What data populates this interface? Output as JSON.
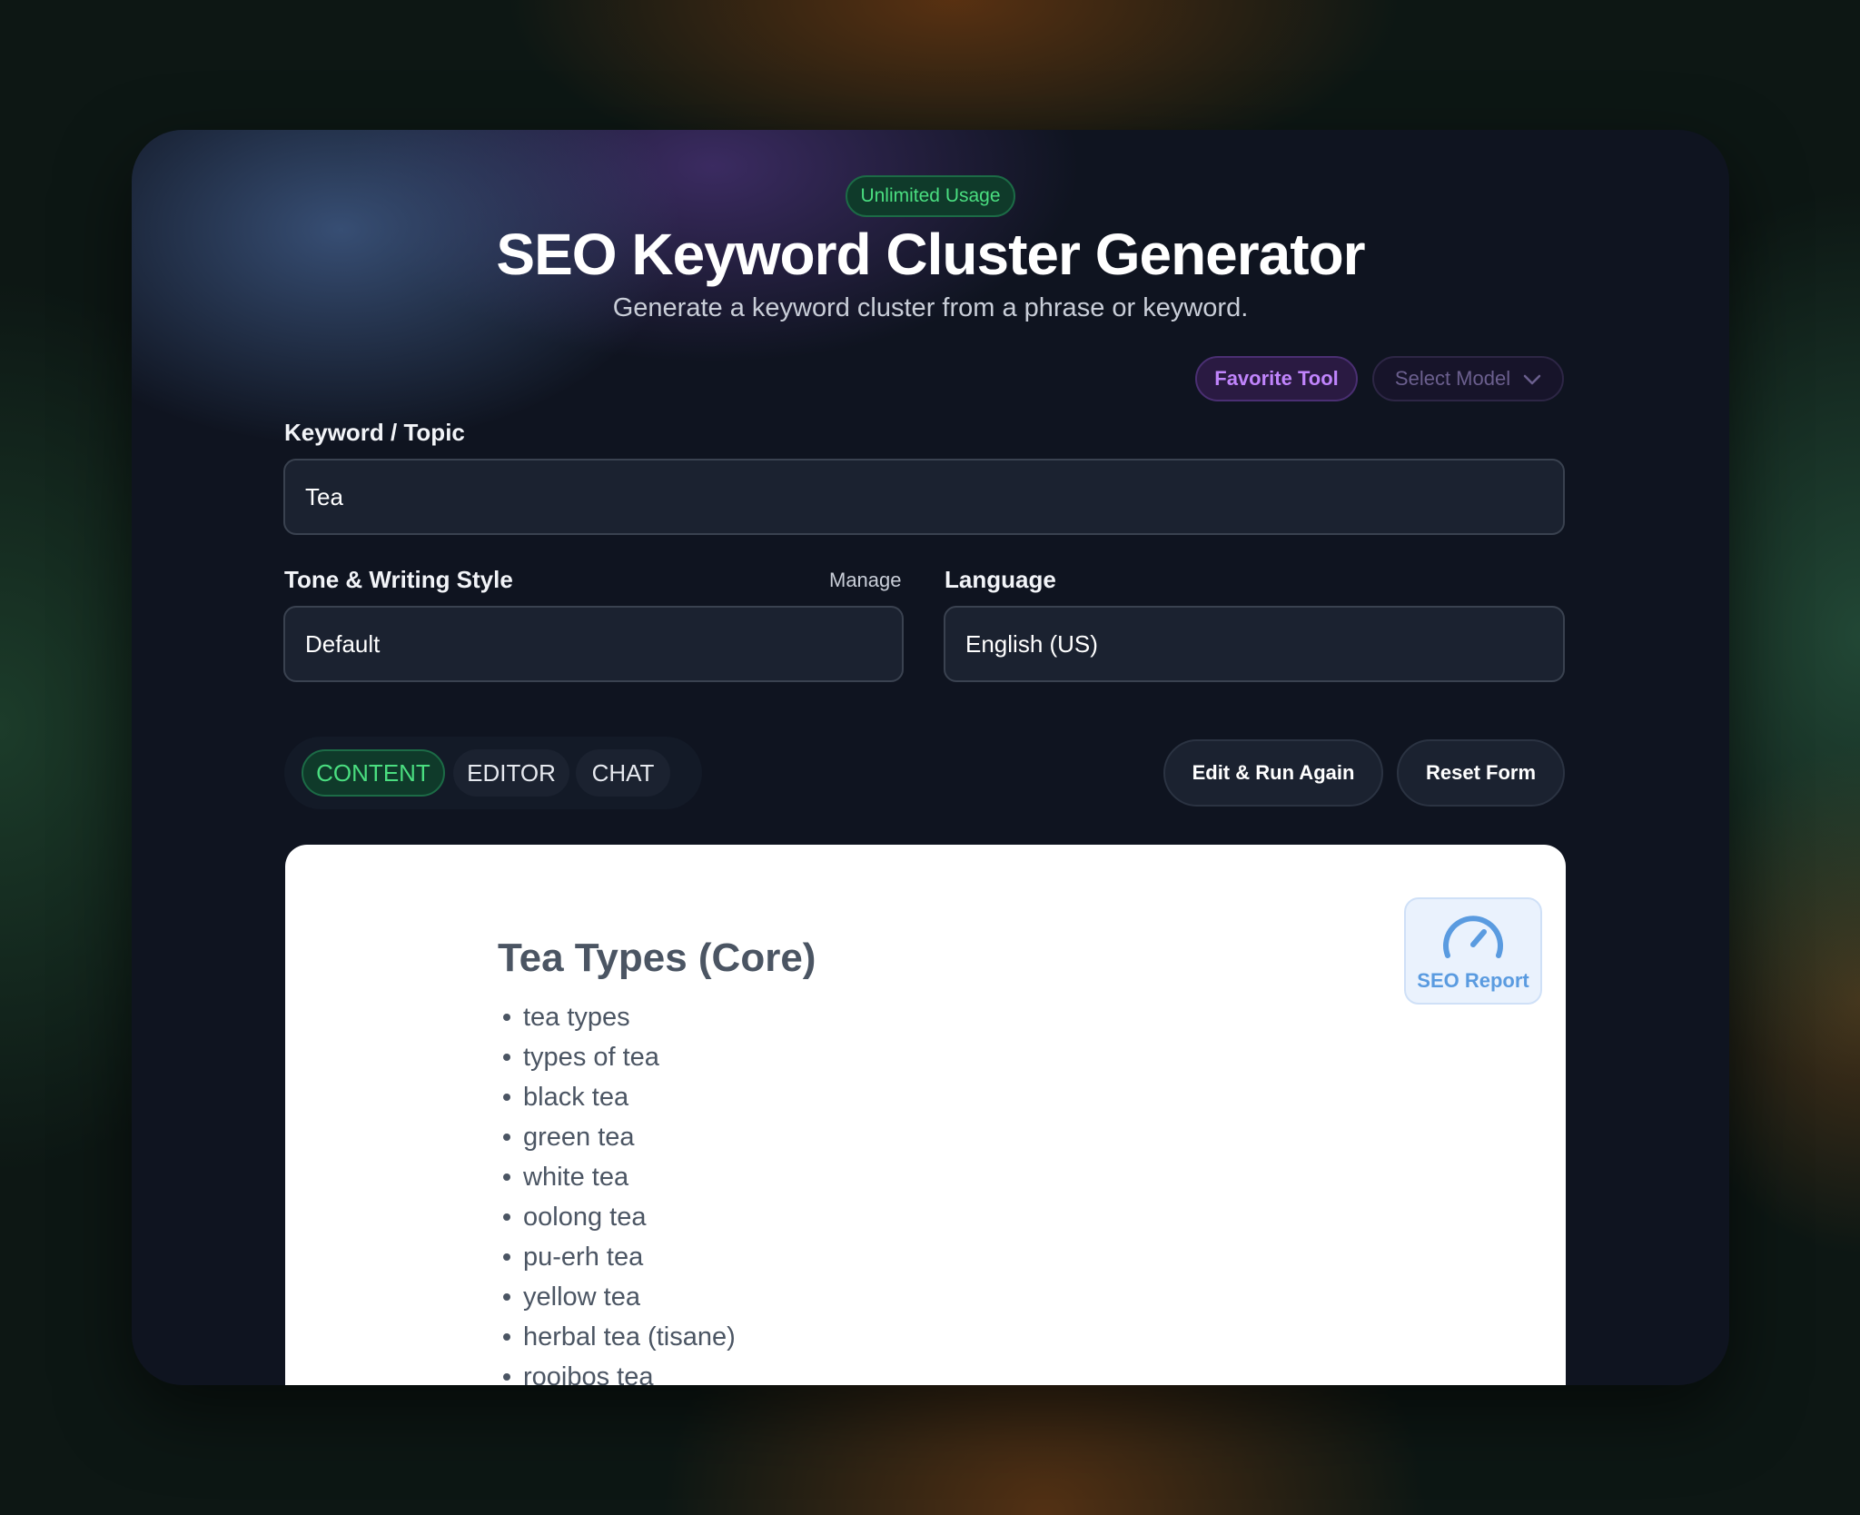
{
  "header": {
    "badge": "Unlimited Usage",
    "title": "SEO Keyword Cluster Generator",
    "subtitle": "Generate a keyword cluster from a phrase or keyword.",
    "favorite_label": "Favorite Tool",
    "model_placeholder": "Select Model"
  },
  "form": {
    "keyword_label": "Keyword / Topic",
    "keyword_value": "Tea",
    "tone_label": "Tone & Writing Style",
    "manage_label": "Manage",
    "tone_value": "Default",
    "language_label": "Language",
    "language_value": "English (US)"
  },
  "tabs": [
    {
      "label": "CONTENT",
      "active": true
    },
    {
      "label": "EDITOR",
      "active": false
    },
    {
      "label": "CHAT",
      "active": false
    }
  ],
  "actions": {
    "edit_run": "Edit & Run Again",
    "reset": "Reset Form"
  },
  "content": {
    "seo_report_label": "SEO Report",
    "heading": "Tea Types (Core)",
    "keywords": [
      "tea types",
      "types of tea",
      "black tea",
      "green tea",
      "white tea",
      "oolong tea",
      "pu-erh tea",
      "yellow tea",
      "herbal tea (tisane)",
      "rooibos tea"
    ]
  },
  "colors": {
    "accent_green": "#4ade80",
    "accent_purple": "#c084fc",
    "seo_blue": "#5a9be0",
    "card_bg": "#0f1420"
  }
}
